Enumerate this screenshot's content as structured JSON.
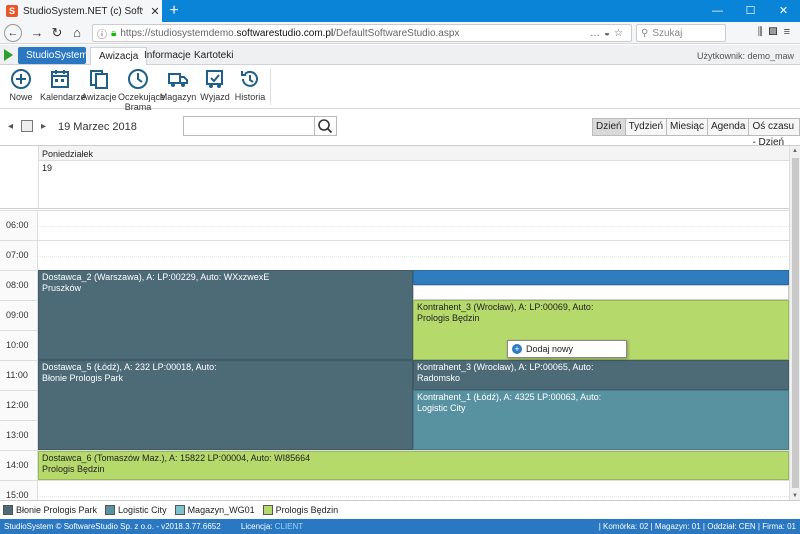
{
  "browser": {
    "tab_title": "StudioSystem.NET (c) Softwa",
    "tab_favicon": "S",
    "url_prefix": "https://studiosystemdemo.",
    "url_domain": "softwarestudio.com.pl",
    "url_path": "/DefaultSoftwareStudio.aspx",
    "search_placeholder": "Szukaj",
    "colors": {
      "titlebar": "#0a84d6"
    }
  },
  "app": {
    "brand_tab": "StudioSystem",
    "tabs": [
      "Awizacja",
      "Informacje",
      "Kartoteki"
    ],
    "active_tab": "Awizacja",
    "user_label": "Użytkownik: demo_maw"
  },
  "ribbon": {
    "buttons": [
      {
        "label": "Nowe",
        "icon": "plus-circle-icon"
      },
      {
        "label": "Kalendarze",
        "icon": "calendar-icon"
      },
      {
        "label": "Awizacje",
        "icon": "documents-icon"
      },
      {
        "label": "Oczekujące Brama",
        "icon": "clock-icon"
      },
      {
        "label": "Magazyn",
        "icon": "truck-icon"
      },
      {
        "label": "Wyjazd",
        "icon": "truck-check-icon"
      },
      {
        "label": "Historia",
        "icon": "history-icon"
      }
    ]
  },
  "toolbar": {
    "date": "19 Marzec 2018",
    "views": [
      "Dzień",
      "Tydzień",
      "Miesiąc",
      "Agenda",
      "Oś czasu - Dzień"
    ],
    "active_view": "Dzień"
  },
  "calendar": {
    "day_name": "Poniedziałek",
    "day_number": "19",
    "hours": [
      "06:00",
      "07:00",
      "08:00",
      "09:00",
      "10:00",
      "11:00",
      "12:00",
      "13:00",
      "14:00",
      "15:00"
    ],
    "events": [
      {
        "line1": "Dostawca_2 (Warszawa), A: LP:00229, Auto: WXxzwexE",
        "line2": "Pruszków",
        "color": "dark"
      },
      {
        "line1": "",
        "line2": "",
        "color": "blue"
      },
      {
        "line1": "Kontrahent_3 (Wrocław), A: LP:00069, Auto:",
        "line2": "Prologis Będzin",
        "color": "green"
      },
      {
        "line1": "Dostawca_5 (Łódź), A: 232 LP:00018, Auto:",
        "line2": "Błonie Prologis Park",
        "color": "dark"
      },
      {
        "line1": "Kontrahent_3 (Wrocław), A: LP:00065, Auto:",
        "line2": "Radomsko",
        "color": "dark"
      },
      {
        "line1": "Kontrahent_1 (Łódź), A: 4325 LP:00063, Auto:",
        "line2": "Logistic City",
        "color": "teal"
      },
      {
        "line1": "Dostawca_6 (Tomaszów Maz.), A: 15822 LP:00004, Auto: WI85664",
        "line2": "Prologis Będzin",
        "color": "green"
      }
    ],
    "context_menu": "Dodaj nowy"
  },
  "legend": [
    {
      "label": "Błonie Prologis Park",
      "color": "#4d6a77"
    },
    {
      "label": "Logistic City",
      "color": "#5892a0"
    },
    {
      "label": "Magazyn_WG01",
      "color": "#7cc3cf"
    },
    {
      "label": "Prologis Będzin",
      "color": "#b6d96c"
    }
  ],
  "status": {
    "left": "StudioSystem © SoftwareStudio Sp. z o.o. - v2018.3.77.6652",
    "license_label": "Licencja:",
    "license_value": "CLIENT",
    "right": "| Komórka: 02 | Magazyn: 01 | Oddział: CEN | Firma: 01"
  }
}
